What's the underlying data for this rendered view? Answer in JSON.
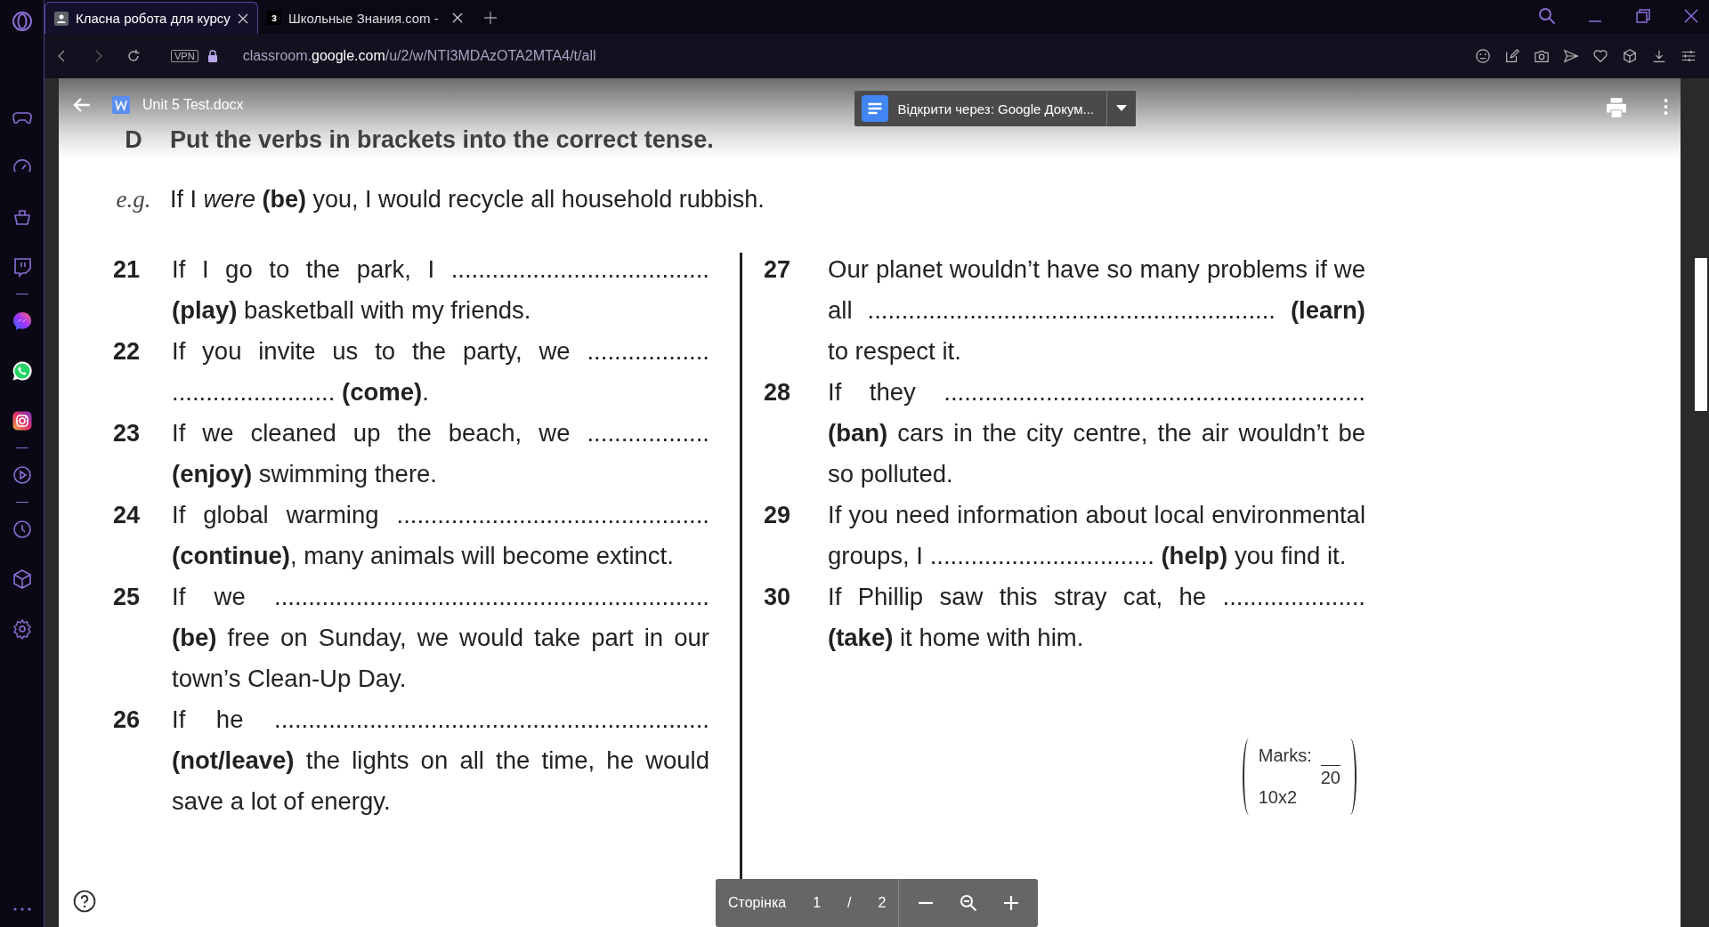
{
  "browser": {
    "tabs": [
      {
        "title": "Класна робота для курсу",
        "kind": "page",
        "selected": true
      },
      {
        "title": "Школьные Знания.com -",
        "kind": "letter",
        "icon_letter": "з",
        "selected": false
      }
    ],
    "vpn": "VPN",
    "url": {
      "prefix": "classroom.",
      "domain": "google.com",
      "path": "/u/2/w/NTI3MDAzOTA2MTA4/t/all"
    }
  },
  "viewer": {
    "file_name": "Unit 5 Test.docx",
    "open_with": "Відкрити через: Google Докум...",
    "page_label": "Сторінка",
    "page": "1",
    "page_separator": "/",
    "page_total": "2"
  },
  "exercise": {
    "letter": "D",
    "instruction": "Put the verbs in brackets into the correct tense.",
    "example_label": "e.g.",
    "example": "If I *were* **(be)** you, I would recycle all household rubbish.",
    "columns": [
      [
        {
          "number": "21",
          "text": "If I go to the park, I ...................................... **(play)** basketball with my friends."
        },
        {
          "number": "22",
          "text": "If you invite us to the party, we .................. ........................ **(come)**."
        },
        {
          "number": "23",
          "text": "If we cleaned up the beach, we .................. **(enjoy)** swimming there."
        },
        {
          "number": "24",
          "text": "If global warming .............................................. **(continue)**, many animals will become extinct."
        },
        {
          "number": "25",
          "text": "If we ................................................................ **(be)** free on Sunday, we would take part in our town’s Clean-Up Day."
        },
        {
          "number": "26",
          "text": "If he ................................................................ **(not/leave)** the lights on all the time, he would save a lot of energy."
        }
      ],
      [
        {
          "number": "27",
          "text": "Our planet wouldn’t have so many problems if we all ............................................................ **(learn)** to respect it."
        },
        {
          "number": "28",
          "text": "If they .............................................................. **(ban)** cars in the city centre, the air wouldn’t be so polluted."
        },
        {
          "number": "29",
          "text": "If you need information about local environmental groups, I ................................. **(help)** you find it."
        },
        {
          "number": "30",
          "text": "If Phillip saw this stray cat, he ..................... **(take)** it home with him."
        }
      ]
    ],
    "marks": {
      "label": "Marks:",
      "calc": "10x2",
      "total": "20"
    }
  }
}
